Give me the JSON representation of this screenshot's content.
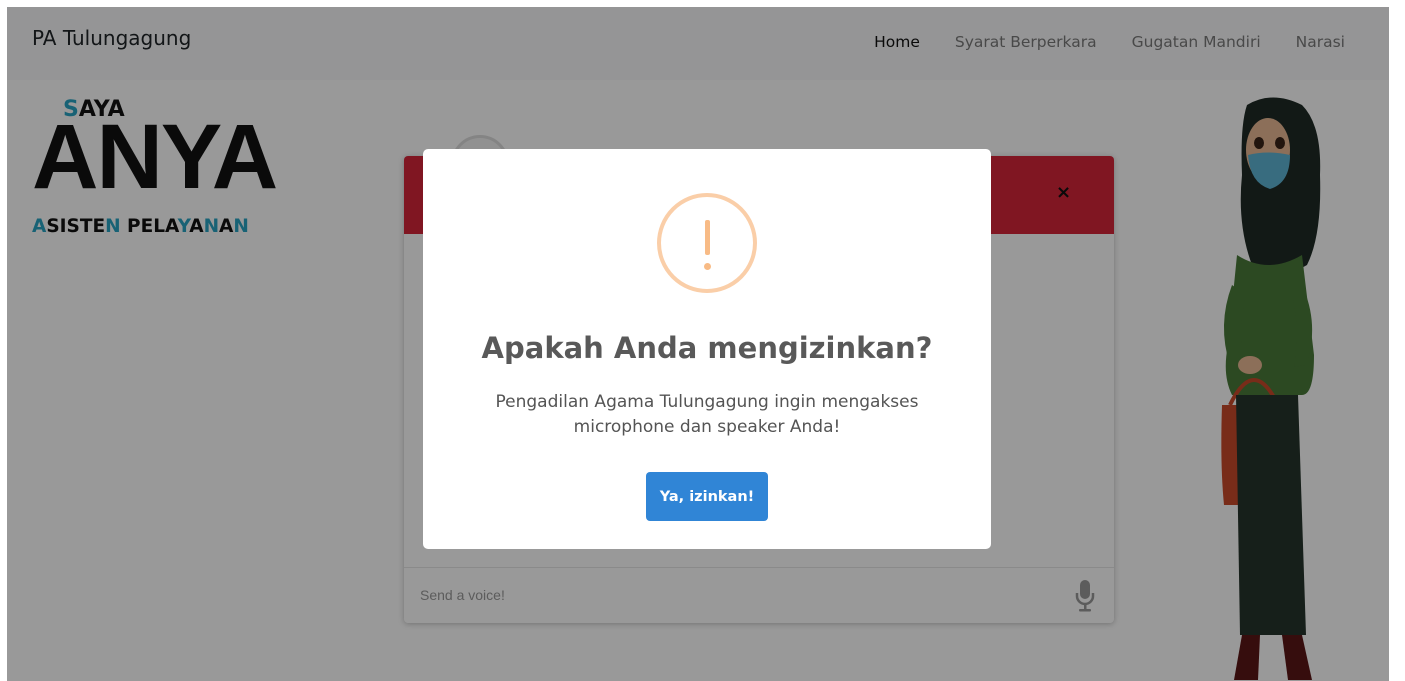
{
  "navbar": {
    "brand": "PA Tulungagung",
    "links": [
      "Home",
      "Syarat Berperkara",
      "Gugatan Mandiri",
      "Narasi"
    ]
  },
  "logo": {
    "saya_first": "S",
    "saya_rest": "AYA",
    "anya": "ANYA",
    "sub_parts": [
      "A",
      "SISTE",
      "N",
      " PELA",
      "Y",
      "A",
      "N",
      "A",
      "N"
    ]
  },
  "chat": {
    "close_symbol": "×",
    "input_placeholder": "Send a voice!"
  },
  "modal": {
    "icon": "warning-icon",
    "title": "Apakah Anda mengizinkan?",
    "text": "Pengadilan Agama Tulungagung ingin mengakses microphone dan speaker Anda!",
    "confirm_label": "Ya, izinkan!"
  },
  "colors": {
    "accent": "#3085d6",
    "chat_header": "#d6263a",
    "logo_teal": "#28a4c4",
    "warning": "#f8bb86"
  }
}
